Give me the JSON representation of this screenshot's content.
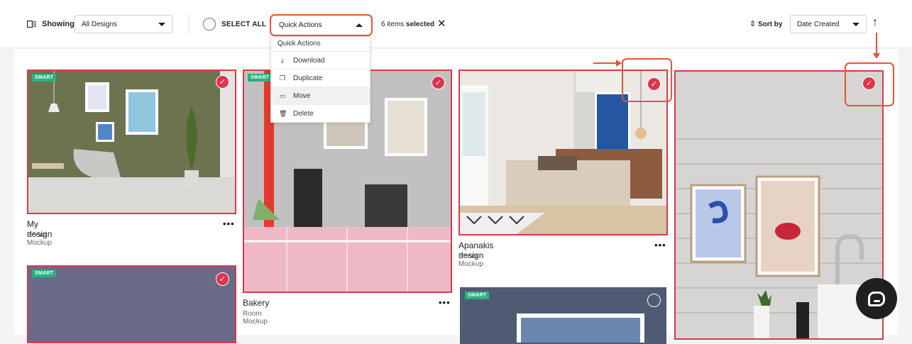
{
  "toolbar": {
    "showing_label": "Showing",
    "showing_value": "All Designs",
    "select_all_label": "SELECT ALL",
    "quick_actions_label": "Quick Actions",
    "selected_count": "6 items",
    "selected_word": "selected",
    "sort_label": "Sort by",
    "sort_value": "Date Created"
  },
  "quick_actions_menu": {
    "header": "Quick Actions",
    "items": [
      {
        "label": "Download",
        "icon": "download-icon"
      },
      {
        "label": "Duplicate",
        "icon": "duplicate-icon"
      },
      {
        "label": "Move",
        "icon": "move-icon"
      },
      {
        "label": "Delete",
        "icon": "trash-icon"
      }
    ]
  },
  "cards": [
    {
      "badge": "SMART",
      "title": "My design",
      "subtitle": "Room Mockup",
      "selected": true
    },
    {
      "badge": "SMART",
      "title": "Bakery",
      "subtitle": "Room Mockup",
      "selected": true
    },
    {
      "title": "Apanakis design",
      "subtitle": "Room Mockup",
      "selected": true
    },
    {
      "selected": true
    },
    {
      "badge": "SMART",
      "selected": true
    },
    {
      "badge": "SMART",
      "selected": false
    }
  ],
  "menu_dots": "•••",
  "colors": {
    "accent_red": "#e0344d",
    "annotation_orange": "#e55535",
    "smart_green": "#2bb07f"
  }
}
